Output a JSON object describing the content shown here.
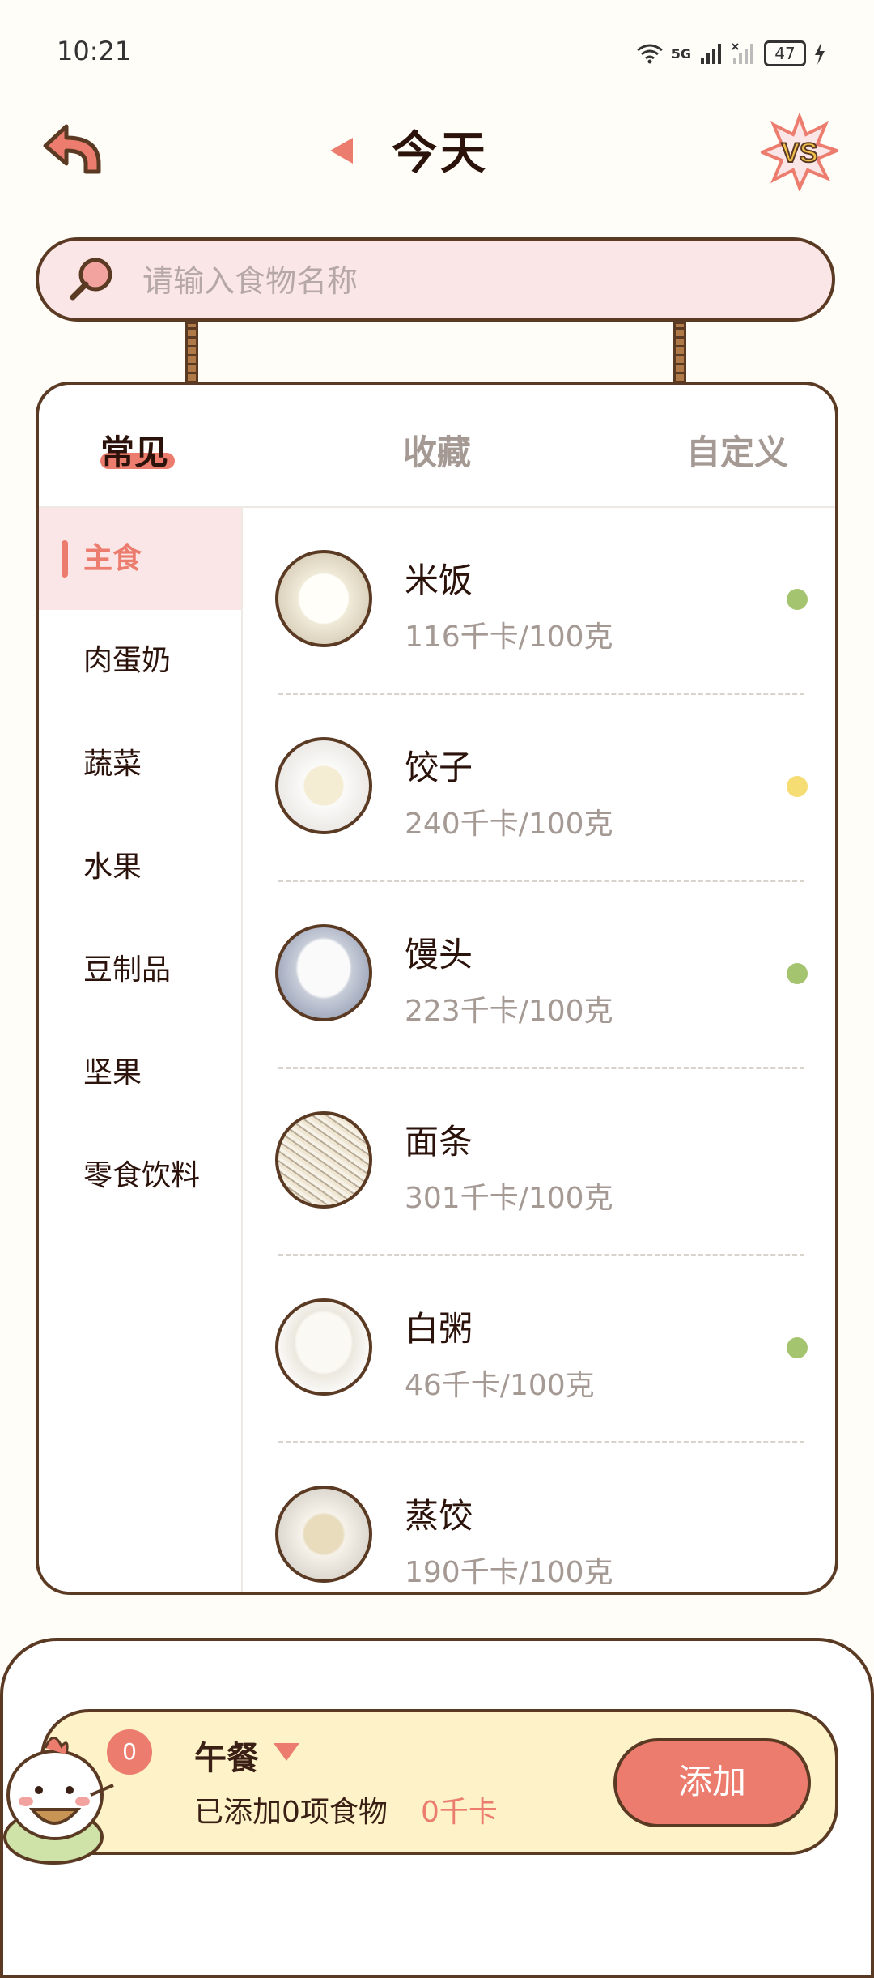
{
  "status_bar": {
    "time": "10:21",
    "network": "5G",
    "battery": "47"
  },
  "header": {
    "title": "今天",
    "back_icon": "back-arrow-icon",
    "vs_icon": "vs-icon"
  },
  "search": {
    "placeholder": "请输入食物名称",
    "value": ""
  },
  "tabs": [
    {
      "label": "常见",
      "active": true
    },
    {
      "label": "收藏",
      "active": false
    },
    {
      "label": "自定义",
      "active": false
    }
  ],
  "categories": [
    {
      "label": "主食",
      "active": true
    },
    {
      "label": "肉蛋奶",
      "active": false
    },
    {
      "label": "蔬菜",
      "active": false
    },
    {
      "label": "水果",
      "active": false
    },
    {
      "label": "豆制品",
      "active": false
    },
    {
      "label": "坚果",
      "active": false
    },
    {
      "label": "零食饮料",
      "active": false
    }
  ],
  "foods": [
    {
      "name": "米饭",
      "kcal": "116千卡/100克",
      "dot": "#a5c46f"
    },
    {
      "name": "饺子",
      "kcal": "240千卡/100克",
      "dot": "#f5dc73"
    },
    {
      "name": "馒头",
      "kcal": "223千卡/100克",
      "dot": "#a5c46f"
    },
    {
      "name": "面条",
      "kcal": "301千卡/100克",
      "dot": ""
    },
    {
      "name": "白粥",
      "kcal": "46千卡/100克",
      "dot": "#a5c46f"
    },
    {
      "name": "蒸饺",
      "kcal": "190千卡/100克",
      "dot": ""
    }
  ],
  "meal": {
    "badge_count": "0",
    "name": "午餐",
    "summary": "已添加0项食物",
    "kcal": "0千卡",
    "add_label": "添加"
  },
  "colors": {
    "accent": "#ec7d6e",
    "outline": "#5b3a24",
    "search_bg": "#fbe6e7",
    "meal_bg": "#fdf2c8"
  }
}
